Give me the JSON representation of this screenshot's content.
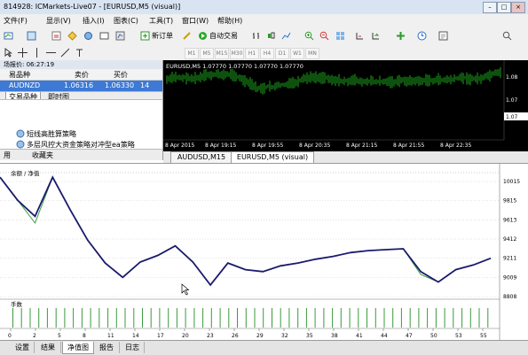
{
  "window": {
    "title": "814928: ICMarkets-Live07 - [EURUSD,M5 (visual)]"
  },
  "menu": {
    "items": [
      "文件(F)",
      "显示(V)",
      "插入(I)",
      "图表(C)",
      "工具(T)",
      "窗口(W)",
      "帮助(H)"
    ]
  },
  "toolbar": {
    "new_order_label": "新订单",
    "auto_trade_label": "自动交易",
    "timeframes": [
      "M1",
      "M5",
      "M15",
      "M30",
      "H1",
      "H4",
      "D1",
      "W1",
      "MN"
    ]
  },
  "market_watch": {
    "header": "场报价: 06:27:19",
    "columns": [
      "易品种",
      "卖价",
      "买价"
    ],
    "row": {
      "symbol": "AUDNZD",
      "bid": "1.06316",
      "ask": "1.06330",
      "spread": "14"
    },
    "tabs": [
      "交易品种",
      "即时图"
    ]
  },
  "navigator": {
    "items": [
      "短线高胜算策略",
      "多层风控大资金策略对冲型ea策略"
    ],
    "tabs": [
      "用",
      "收藏夹"
    ]
  },
  "mini_chart": {
    "caption": "EURUSD,M5  1.07770 1.07770 1.07770 1.07770",
    "price_labels": [
      "1.08",
      "1.07",
      "1.07"
    ],
    "time_labels": [
      "8 Apr 2015",
      "8 Apr 19:15",
      "8 Apr 19:55",
      "8 Apr 20:35",
      "8 Apr 21:15",
      "8 Apr 21:55",
      "8 Apr 22:35"
    ]
  },
  "chart_tabs": [
    "AUDUSD,M15",
    "EURUSD,M5 (visual)"
  ],
  "equity_chart": {
    "legend": "余额 / 净值",
    "lot_label": "手数"
  },
  "chart_data": {
    "type": "line",
    "x": [
      0,
      2,
      4,
      6,
      8,
      10,
      12,
      14,
      16,
      18,
      20,
      22,
      24,
      26,
      28,
      30,
      32,
      34,
      36,
      38,
      40,
      42,
      44,
      46,
      48,
      50,
      52,
      54,
      56
    ],
    "series": [
      {
        "name": "余额",
        "color": "#1a1a6e",
        "values": [
          10060,
          9820,
          9650,
          10060,
          9720,
          9400,
          9160,
          9010,
          9170,
          9240,
          9340,
          9170,
          8930,
          9160,
          9090,
          9070,
          9130,
          9160,
          9200,
          9230,
          9270,
          9290,
          9300,
          9310,
          9070,
          8960,
          9090,
          9140,
          9210
        ]
      },
      {
        "name": "净值",
        "color": "#3c9a3c",
        "values": [
          10060,
          9820,
          9580,
          10060,
          9720,
          9400,
          9160,
          9010,
          9170,
          9240,
          9340,
          9170,
          8930,
          9160,
          9090,
          9070,
          9130,
          9160,
          9200,
          9230,
          9270,
          9290,
          9300,
          9310,
          9040,
          8960,
          9090,
          9140,
          9210
        ]
      }
    ],
    "ylim": [
      8808,
      10090
    ],
    "y_ticks": [
      "10015",
      "9815",
      "9613",
      "9412",
      "9211",
      "9009",
      "8808"
    ],
    "x_ticks": [
      "0",
      "2",
      "5",
      "8",
      "11",
      "14",
      "17",
      "20",
      "23",
      "26",
      "29",
      "32",
      "35",
      "38",
      "41",
      "44",
      "47",
      "50",
      "53",
      "55"
    ],
    "lot_bar_count": 56
  },
  "tester_tabs": {
    "items": [
      "设置",
      "结果",
      "净值图",
      "报告",
      "日志"
    ],
    "active": "净值图"
  },
  "colors": {
    "chart_bg": "#000000",
    "candle_green": "#22cc22",
    "selected_row": "#3d79d5",
    "balance_line": "#1a1a6e",
    "equity_line": "#3c9a3c"
  }
}
